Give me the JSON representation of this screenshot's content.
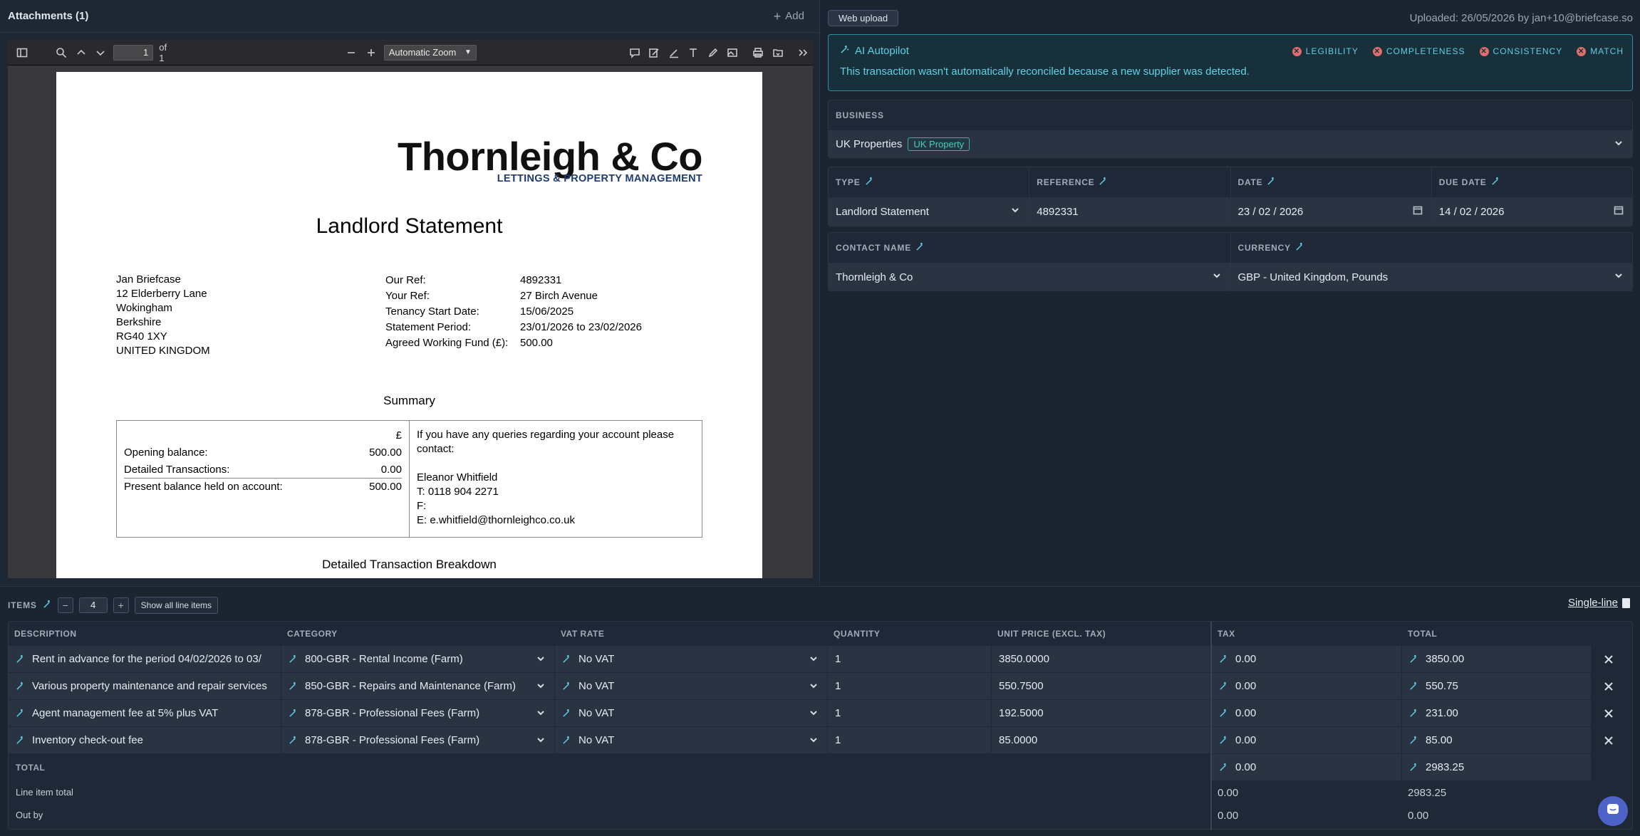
{
  "attachments": {
    "title": "Attachments (1)",
    "add_label": "Add"
  },
  "viewer": {
    "page_value": "1",
    "page_of": "of 1",
    "zoom": "Automatic Zoom"
  },
  "document": {
    "brand": "Thornleigh & Co",
    "tagline": "LETTINGS & PROPERTY MANAGEMENT",
    "title": "Landlord Statement",
    "address": [
      "Jan Briefcase",
      "12 Elderberry Lane",
      "Wokingham",
      "Berkshire",
      "RG40 1XY",
      "UNITED KINGDOM"
    ],
    "refs": [
      {
        "k": "Our Ref:",
        "v": "4892331"
      },
      {
        "k": "Your Ref:",
        "v": "27 Birch Avenue"
      },
      {
        "k": "Tenancy Start Date:",
        "v": "15/06/2025"
      },
      {
        "k": "Statement Period:",
        "v": "23/01/2026 to 23/02/2026"
      },
      {
        "k": "Agreed Working Fund (£):",
        "v": "500.00"
      }
    ],
    "summary_title": "Summary",
    "currency_symbol": "£",
    "summary_rows": [
      {
        "k": "Opening balance:",
        "v": "500.00"
      },
      {
        "k": "Detailed Transactions:",
        "v": "0.00"
      },
      {
        "k": "Present balance held on account:",
        "v": "500.00"
      }
    ],
    "contact_lines": [
      "If you have any queries regarding your account please contact:",
      "",
      "Eleanor Whitfield",
      "T: 0118 904 2271",
      "F:",
      "E: e.whitfield@thornleighco.co.uk"
    ],
    "breakdown_title": "Detailed Transaction Breakdown"
  },
  "header": {
    "upload_source": "Web upload",
    "uploaded_by": "Uploaded: 26/05/2026 by jan+10@briefcase.so"
  },
  "autopilot": {
    "title": "AI Autopilot",
    "message": "This transaction wasn't automatically reconciled because a new supplier was detected.",
    "checks": [
      "LEGIBILITY",
      "COMPLETENESS",
      "CONSISTENCY",
      "MATCH"
    ]
  },
  "form": {
    "business_label": "BUSINESS",
    "business_value": "UK Properties",
    "business_tag": "UK Property",
    "type_label": "TYPE",
    "type_value": "Landlord Statement",
    "reference_label": "REFERENCE",
    "reference_value": "4892331",
    "date_label": "DATE",
    "date_value": "23 / 02 / 2026",
    "due_date_label": "DUE DATE",
    "due_date_value": "14 / 02 / 2026",
    "contact_label": "CONTACT NAME",
    "contact_value": "Thornleigh & Co",
    "currency_label": "CURRENCY",
    "currency_value": "GBP - United Kingdom, Pounds"
  },
  "items": {
    "label": "ITEMS",
    "count": "4",
    "show_all": "Show all line items",
    "single_line": "Single-line",
    "columns": [
      "DESCRIPTION",
      "CATEGORY",
      "VAT RATE",
      "QUANTITY",
      "UNIT PRICE (EXCL. TAX)",
      "TAX",
      "TOTAL"
    ],
    "rows": [
      {
        "description": "Rent in advance for the period 04/02/2026 to 03/",
        "category": "800-GBR - Rental Income (Farm)",
        "vat": "No VAT",
        "qty": "1",
        "unit_price": "3850.0000",
        "tax": "0.00",
        "total": "3850.00"
      },
      {
        "description": "Various property maintenance and repair services",
        "category": "850-GBR - Repairs and Maintenance (Farm)",
        "vat": "No VAT",
        "qty": "1",
        "unit_price": "550.7500",
        "tax": "0.00",
        "total": "550.75"
      },
      {
        "description": "Agent management fee at 5% plus VAT",
        "category": "878-GBR - Professional Fees (Farm)",
        "vat": "No VAT",
        "qty": "1",
        "unit_price": "192.5000",
        "tax": "0.00",
        "total": "231.00"
      },
      {
        "description": "Inventory check-out fee",
        "category": "878-GBR - Professional Fees (Farm)",
        "vat": "No VAT",
        "qty": "1",
        "unit_price": "85.0000",
        "tax": "0.00",
        "total": "85.00"
      }
    ],
    "total_label": "TOTAL",
    "total_tax": "0.00",
    "total_total": "2983.25",
    "line_item_total_label": "Line item total",
    "line_item_total_tax": "0.00",
    "line_item_total_total": "2983.25",
    "out_by_label": "Out by",
    "out_by_tax": "0.00",
    "out_by_total": "0.00"
  },
  "colors": {
    "accent": "#5ecfe4",
    "tag": "#3fd0bb",
    "error": "#e26d6d",
    "chat": "#4e63c7"
  }
}
